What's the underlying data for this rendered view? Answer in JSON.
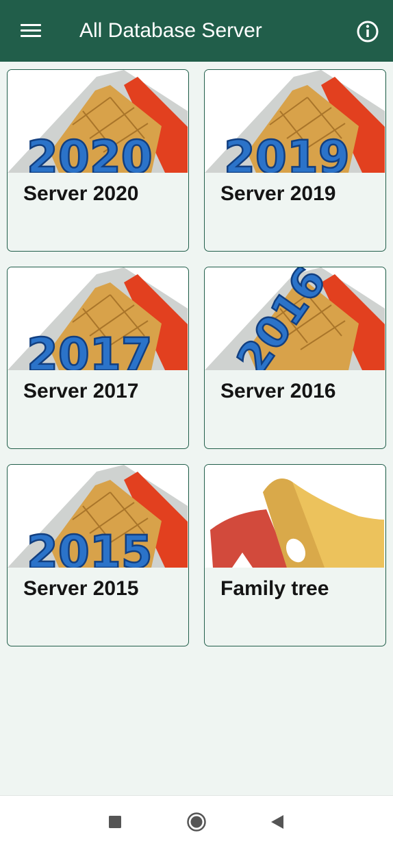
{
  "app_bar": {
    "title": "All Database Server",
    "background": "#215e4a",
    "menu_icon": "hamburger-menu-icon",
    "info_icon": "info-icon"
  },
  "cards": [
    {
      "label": "Server 2020",
      "image": "sim-card-2020",
      "year_text": "2020"
    },
    {
      "label": "Server 2019",
      "image": "sim-card-2019",
      "year_text": "2019"
    },
    {
      "label": "Server 2017",
      "image": "sim-card-2017",
      "year_text": "2017"
    },
    {
      "label": "Server 2016",
      "image": "sim-card-2016",
      "year_text": "2016"
    },
    {
      "label": "Server 2015",
      "image": "sim-card-2015",
      "year_text": "2015"
    },
    {
      "label": "Family tree",
      "image": "theater-masks"
    }
  ],
  "system_nav": {
    "buttons": [
      "recents-square-icon",
      "home-circle-icon",
      "back-triangle-icon"
    ]
  }
}
